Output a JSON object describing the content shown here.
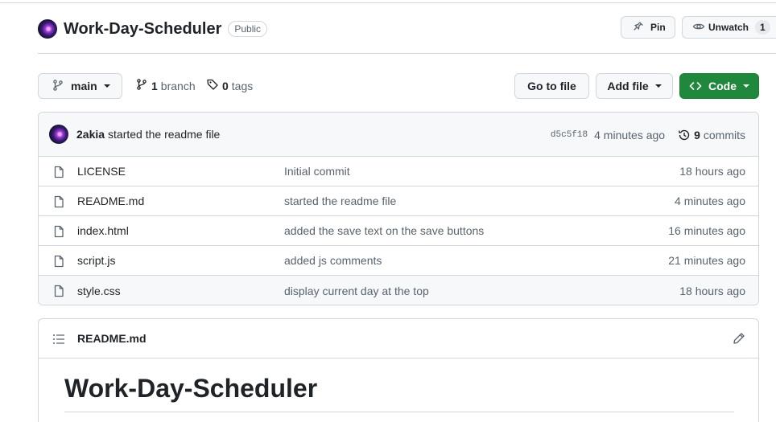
{
  "repo": {
    "name": "Work-Day-Scheduler",
    "visibility": "Public"
  },
  "header_actions": {
    "pin_label": "Pin",
    "watch_label": "Unwatch",
    "watch_count": "1"
  },
  "branch_bar": {
    "current_branch": "main",
    "branch_count": "1",
    "branch_label": "branch",
    "tag_count": "0",
    "tag_label": "tags",
    "goto_file_label": "Go to file",
    "add_file_label": "Add file",
    "code_label": "Code",
    "code_color": "#1f883d"
  },
  "latest_commit": {
    "author": "2akia",
    "message": "started the readme file",
    "sha": "d5c5f18",
    "time": "4 minutes ago",
    "commit_count": "9",
    "commit_label": "commits"
  },
  "files": [
    {
      "name": "LICENSE",
      "message": "Initial commit",
      "time": "18 hours ago",
      "icon": "file-icon"
    },
    {
      "name": "README.md",
      "message": "started the readme file",
      "time": "4 minutes ago",
      "icon": "file-icon"
    },
    {
      "name": "index.html",
      "message": "added the save text on the save buttons",
      "time": "16 minutes ago",
      "icon": "file-icon"
    },
    {
      "name": "script.js",
      "message": "added js comments",
      "time": "21 minutes ago",
      "icon": "file-icon"
    },
    {
      "name": "style.css",
      "message": "display current day at the top",
      "time": "18 hours ago",
      "icon": "file-icon"
    }
  ],
  "readme": {
    "file_name": "README.md",
    "heading": "Work-Day-Scheduler"
  }
}
